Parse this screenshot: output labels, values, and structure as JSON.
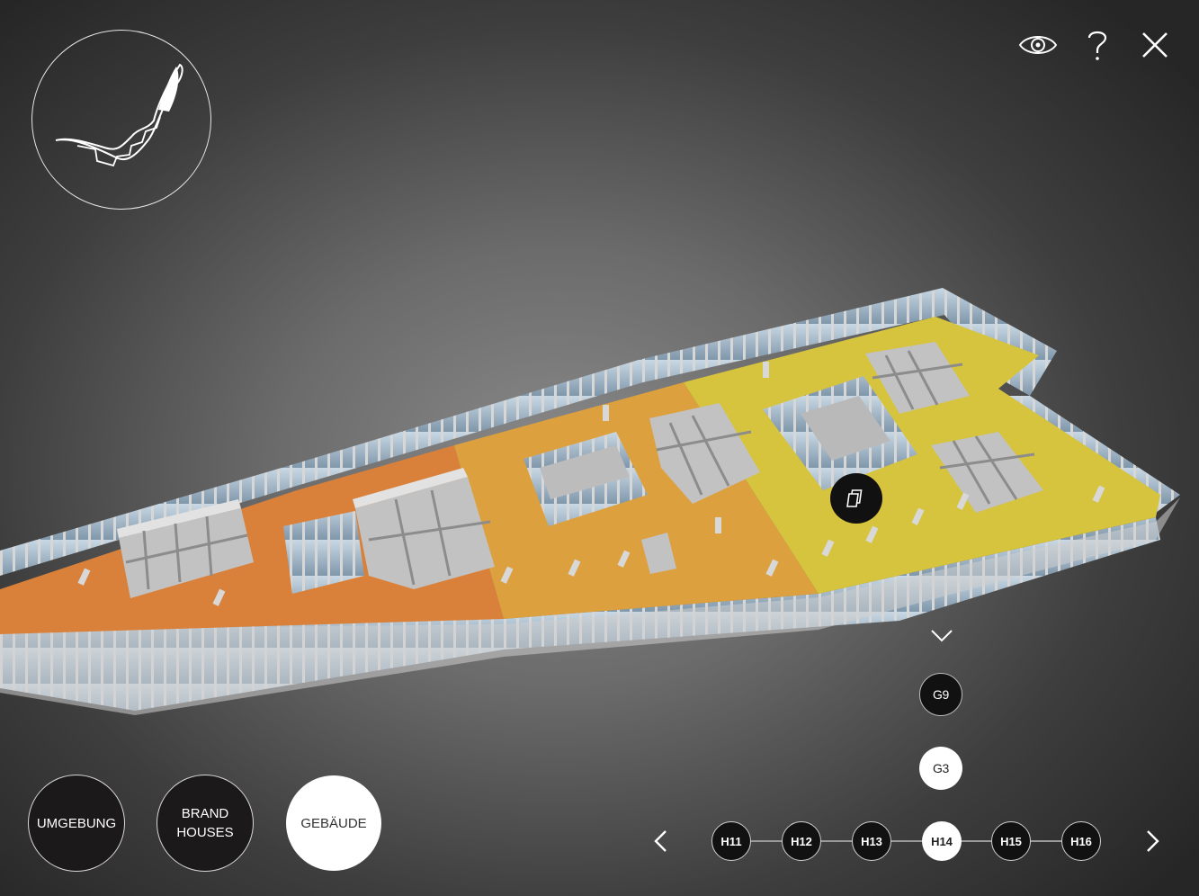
{
  "colors": {
    "zone_orange": "#d9813a",
    "zone_amber": "#dca03f",
    "zone_yellow": "#d6c33e",
    "structure_gray": "#c8c8c8",
    "glass_blue": "#9fb6c9",
    "button_dark": "#111111",
    "button_light": "#ffffff"
  },
  "icons": {
    "site_map": "site-map-icon",
    "view": "eye-icon",
    "help": "question-mark-icon",
    "close": "close-icon",
    "info_pin": "stacked-pages-icon",
    "floor_toggle": "chevron-down-icon",
    "prev": "chevron-left-icon",
    "next": "chevron-right-icon"
  },
  "floors": [
    {
      "label": "G9",
      "active": false
    },
    {
      "label": "G3",
      "active": true
    }
  ],
  "modes": [
    {
      "line1": "UMGEBUNG",
      "line2": "",
      "active": false
    },
    {
      "line1": "BRAND",
      "line2": "HOUSES",
      "active": false
    },
    {
      "line1": "GEBÄUDE",
      "line2": "",
      "active": true
    }
  ],
  "houses": [
    {
      "label": "H11",
      "active": false
    },
    {
      "label": "H12",
      "active": false
    },
    {
      "label": "H13",
      "active": false
    },
    {
      "label": "H14",
      "active": true
    },
    {
      "label": "H15",
      "active": false
    },
    {
      "label": "H16",
      "active": false
    }
  ]
}
